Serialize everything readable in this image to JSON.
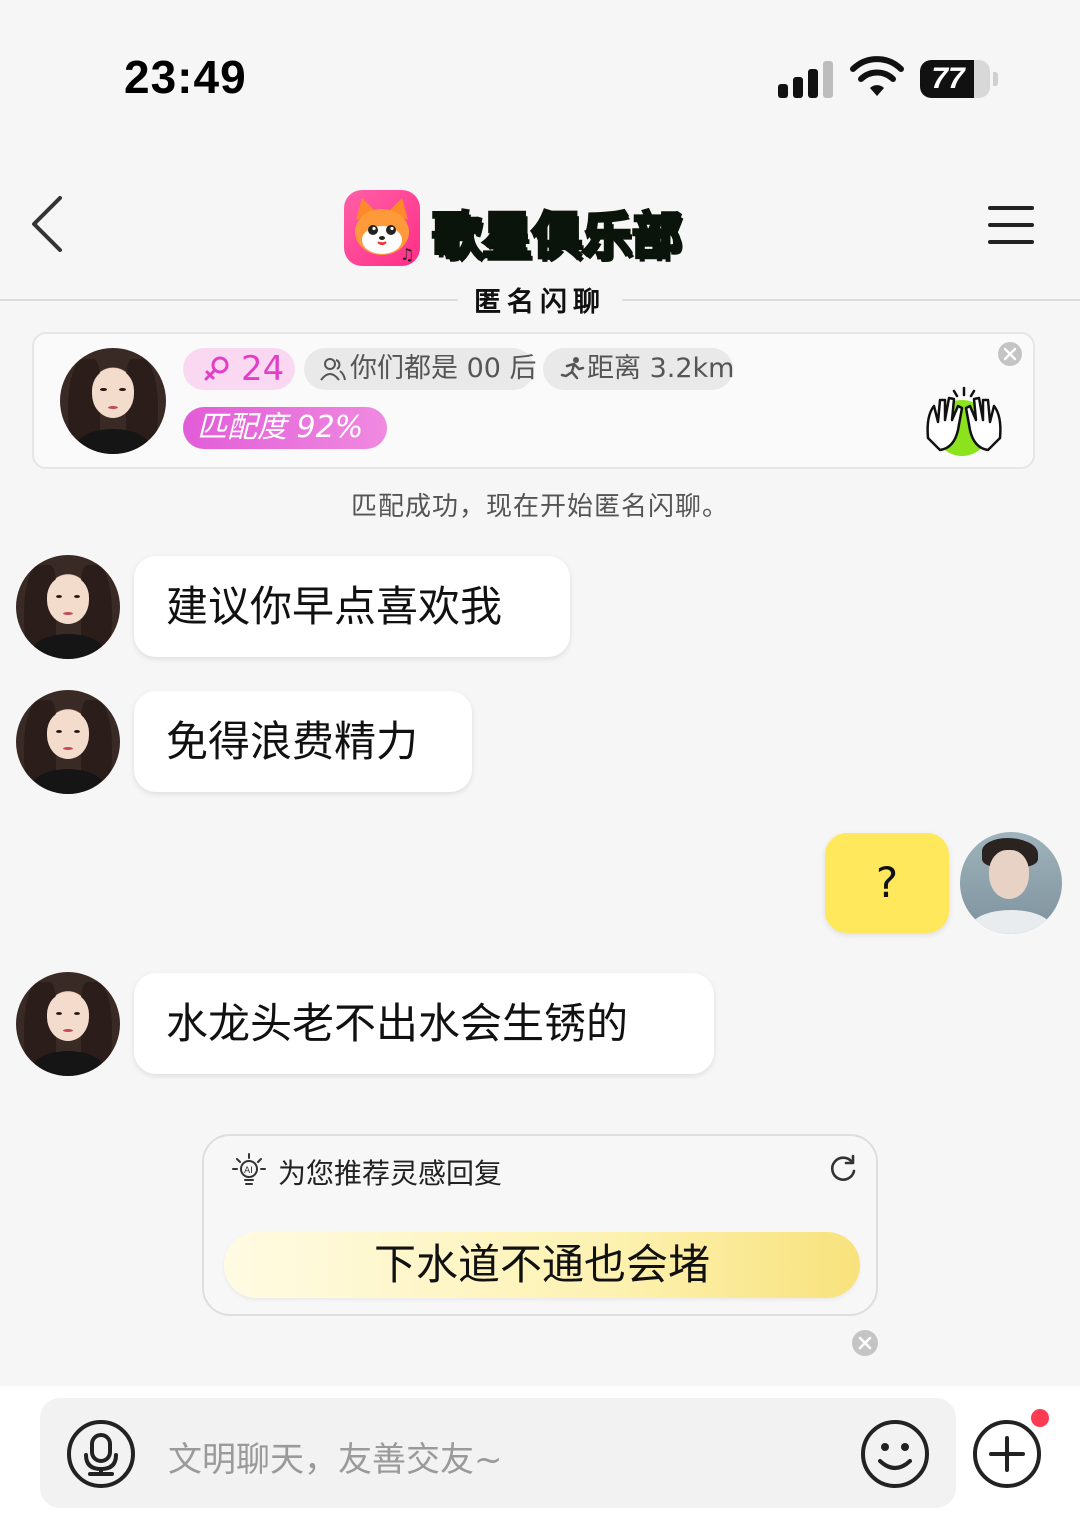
{
  "status_bar": {
    "time": "23:49",
    "battery": "77",
    "battery_level": 0.77
  },
  "header": {
    "app_name": "歌星俱乐部",
    "subtitle": "匿名闪聊",
    "brand_color": "#6cf033"
  },
  "match_card": {
    "age": "24",
    "generation_tag": "你们都是 00 后",
    "distance_tag": "距离 3.2km",
    "match_score": "匹配度 92%"
  },
  "system_message": "匹配成功，现在开始匿名闪聊。",
  "messages": [
    {
      "sender": "other",
      "text": "建议你早点喜欢我"
    },
    {
      "sender": "other",
      "text": "免得浪费精力"
    },
    {
      "sender": "me",
      "text": "?"
    },
    {
      "sender": "other",
      "text": "水龙头老不出水会生锈的"
    }
  ],
  "suggestion": {
    "title": "为您推荐灵感回复",
    "reply": "下水道不通也会堵"
  },
  "input": {
    "placeholder": "文明聊天，友善交友~"
  }
}
